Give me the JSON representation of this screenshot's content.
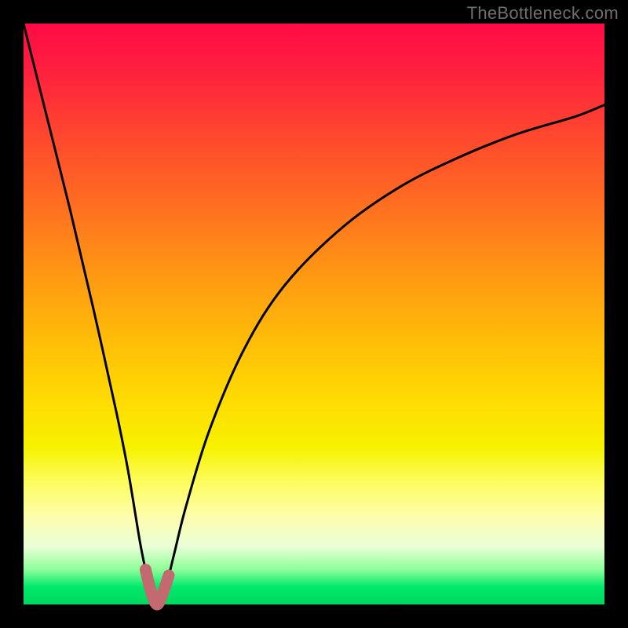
{
  "watermark": "TheBottleneck.com",
  "chart_data": {
    "type": "line",
    "title": "",
    "xlabel": "",
    "ylabel": "",
    "xlim": [
      0,
      100
    ],
    "ylim": [
      0,
      100
    ],
    "grid": false,
    "description": "Bottleneck percentage curve over a rainbow performance gradient. Minimum (optimal) at x≈23.",
    "series": [
      {
        "name": "bottleneck-curve",
        "color": "#000000",
        "x": [
          0,
          4,
          8,
          12,
          16,
          18,
          20,
          21,
          22,
          23,
          24,
          25,
          26,
          28,
          32,
          38,
          45,
          55,
          65,
          75,
          85,
          95,
          100
        ],
        "y": [
          100,
          84,
          68,
          51,
          33,
          23,
          11,
          6,
          2,
          0,
          2,
          5,
          9,
          17,
          30,
          44,
          55,
          65,
          72,
          77,
          81,
          84,
          86
        ]
      },
      {
        "name": "optimal-zone-marker",
        "color": "#c26a6f",
        "x": [
          21,
          22,
          23,
          24,
          25
        ],
        "y": [
          6,
          2,
          0,
          2,
          5
        ]
      }
    ],
    "optimal_x": 23
  }
}
